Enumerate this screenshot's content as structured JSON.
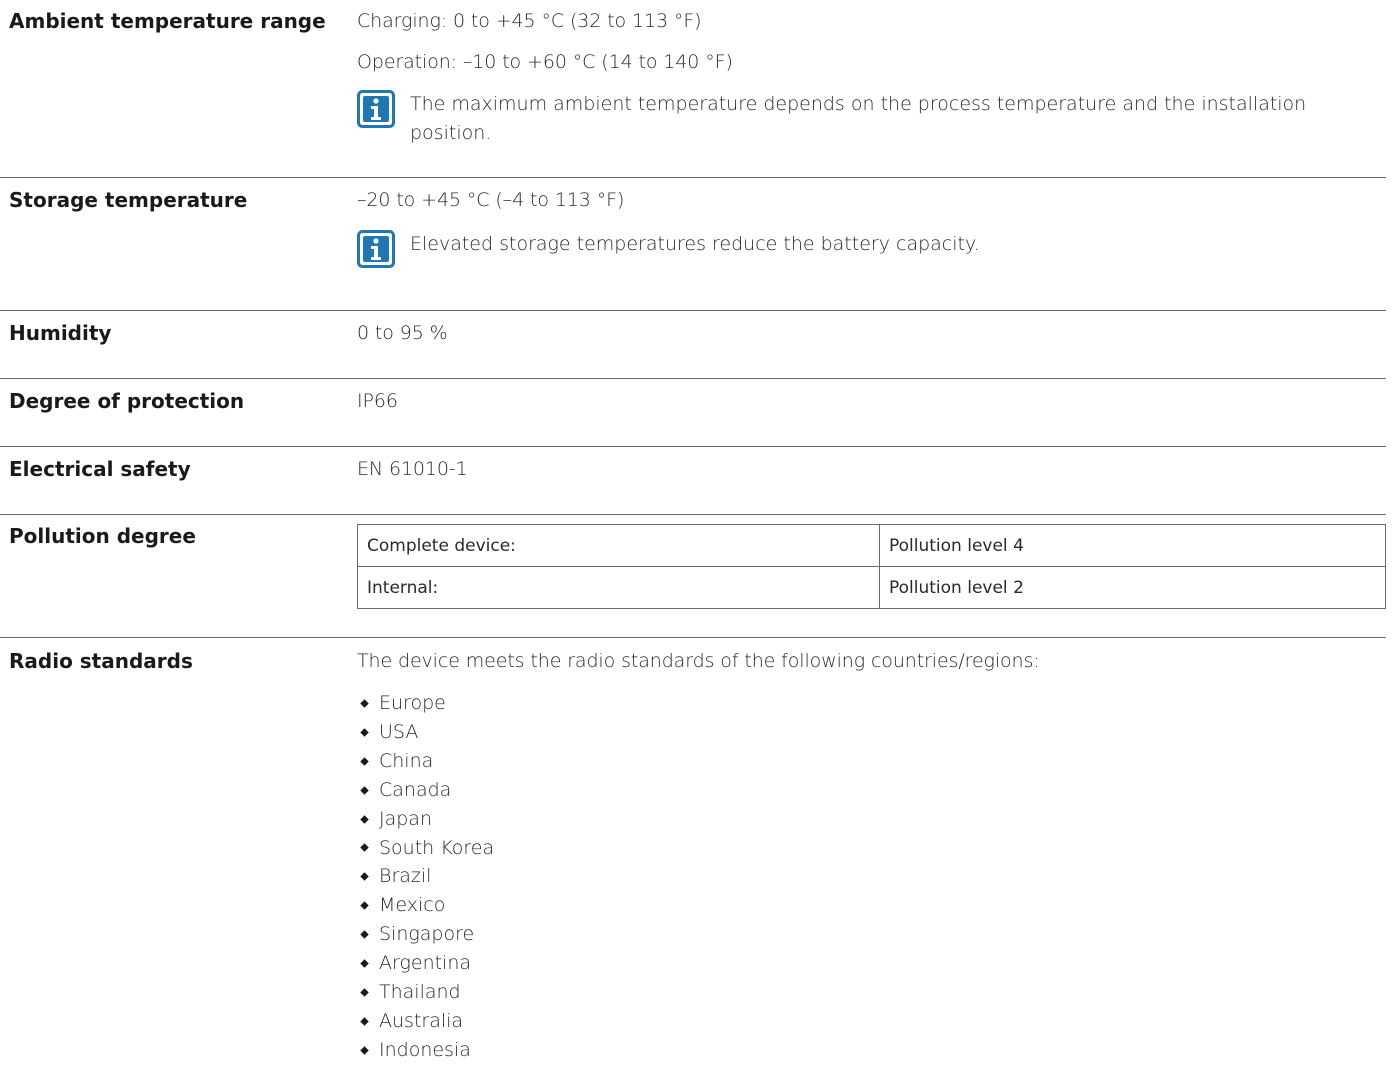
{
  "ambient": {
    "label": "Ambient temperature range",
    "charging": "Charging: 0 to +45 °C (32 to 113 °F)",
    "operation": "Operation: –10 to +60 °C (14 to 140 °F)",
    "note": "The maximum ambient temperature depends on the process temperature and the installation position."
  },
  "storage": {
    "label": "Storage temperature",
    "value": "–20 to +45 °C (–4 to 113 °F)",
    "note": "Elevated storage temperatures reduce the battery capacity."
  },
  "humidity": {
    "label": "Humidity",
    "value": "0 to 95 %"
  },
  "protection": {
    "label": "Degree of protection",
    "value": "IP66"
  },
  "electrical": {
    "label": "Electrical safety",
    "value": "EN 61010-1"
  },
  "pollution": {
    "label": "Pollution degree",
    "rows": [
      {
        "item": "Complete device:",
        "level": "Pollution level 4"
      },
      {
        "item": "Internal:",
        "level": "Pollution level 2"
      }
    ]
  },
  "radio": {
    "label": "Radio standards",
    "intro": "The device meets the radio standards of the following countries/regions:",
    "countries": [
      "Europe",
      "USA",
      "China",
      "Canada",
      "Japan",
      "South Korea",
      "Brazil",
      "Mexico",
      "Singapore",
      "Argentina",
      "Thailand",
      "Australia",
      "Indonesia"
    ]
  },
  "colors": {
    "info_icon": "#1f77b4",
    "rule": "#6b6b6b"
  },
  "icons": {
    "note": "info-icon"
  }
}
